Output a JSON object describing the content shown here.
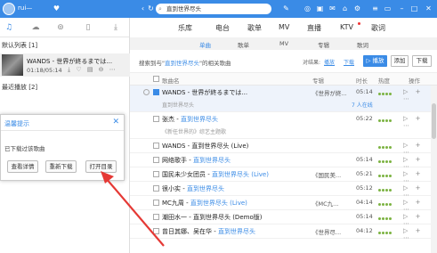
{
  "titlebar": {
    "username": "rui—",
    "search_query": "直到世界尽头"
  },
  "left": {
    "default_list_label": "默认列表 [1]",
    "recent_label": "最近播放 [2]",
    "now_playing": {
      "title": "WANDS - 世界が終るまでは...",
      "time": "01:18/05:14"
    }
  },
  "dialog": {
    "title": "温馨提示",
    "message": "已下载过该歌曲",
    "buttons": [
      "查看详情",
      "重新下载",
      "打开目录"
    ]
  },
  "nav": {
    "items": [
      "乐库",
      "电台",
      "歌单",
      "MV",
      "直播",
      "KTV",
      "歌词"
    ]
  },
  "subnav": {
    "items": [
      "单曲",
      "歌单",
      "MV",
      "专辑",
      "歌词"
    ]
  },
  "results": {
    "text_prefix": "搜索到与\"",
    "query": "直到世界尽头",
    "text_suffix": "\"的相关歌曲",
    "sort_label": "对结果:",
    "sort_options": [
      "播放",
      "下载"
    ],
    "play_button": "▷ 播放",
    "add_button": "添加",
    "download_button": "下载"
  },
  "columns": {
    "title": "歌曲名",
    "album": "专辑",
    "duration": "时长",
    "hot": "热度"
  },
  "rows": [
    {
      "title": "WANDS - 世界が終るまでは...",
      "hl": "",
      "album": "《世界が終...",
      "duration": "05:14",
      "sub": "直到世界尽头",
      "extra": "7 人在线"
    },
    {
      "title": "张杰 - ",
      "hl": "直到世界尽头",
      "album": "",
      "duration": "05:22",
      "sub": "《新任世界的》综艺主题歌",
      "extra": ""
    },
    {
      "title": "WANDS - 直到世界尽头 (Live)",
      "hl": "",
      "album": "",
      "duration": "",
      "sub": "",
      "extra": ""
    },
    {
      "title": "网络歌手 - ",
      "hl": "直到世界尽头",
      "album": "",
      "duration": "05:14",
      "sub": "",
      "extra": ""
    },
    {
      "title": "国民未少女团员 - ",
      "hl": "直到世界尽头 (Live)",
      "album": "《国民美...",
      "duration": "05:21",
      "sub": "",
      "extra": ""
    },
    {
      "title": "很小实 - ",
      "hl": "直到世界尽头",
      "album": "",
      "duration": "05:12",
      "sub": "",
      "extra": ""
    },
    {
      "title": "MC九周 - ",
      "hl": "直到世界尽头 (Live)",
      "album": "《MC九...",
      "duration": "04:14",
      "sub": "",
      "extra": ""
    },
    {
      "title": "潮田水一 - 直到世界尽头 (Demo版)",
      "hl": "",
      "album": "",
      "duration": "05:14",
      "sub": "",
      "extra": ""
    },
    {
      "title": "曾日其娜、吴在华 - ",
      "hl": "直到世界尽头",
      "album": "《世界尽...",
      "duration": "04:12",
      "sub": "",
      "extra": ""
    }
  ]
}
